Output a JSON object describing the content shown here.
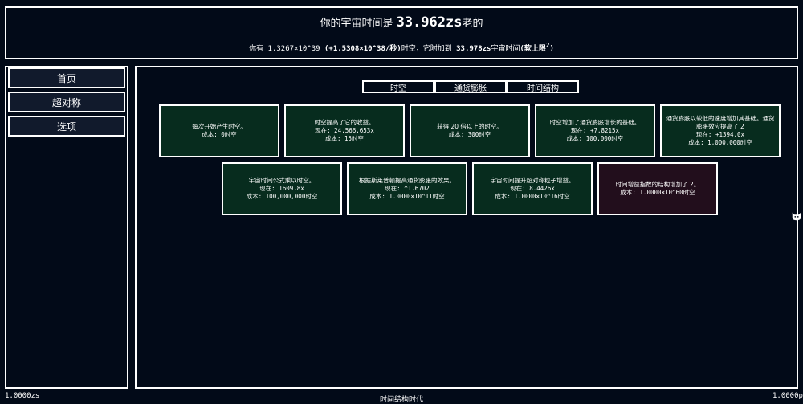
{
  "header": {
    "line1_prefix": "你的宇宙时间是 ",
    "line1_value": "33.962zs",
    "line1_suffix": "老的",
    "line2_prefix": "你有  ",
    "line2_amount": "1.3267×10^39",
    "line2_rate": "(+1.5308×10^38/秒)",
    "line2_mid": "时空，它附加到  ",
    "line2_value": "33.978zs",
    "line2_after": "宇宙时间",
    "line2_bold": "(软上限",
    "line2_sup": "2",
    "line2_close": ")"
  },
  "sidebar": {
    "items": [
      {
        "label": "首页"
      },
      {
        "label": "超对称"
      },
      {
        "label": "选项"
      }
    ]
  },
  "tabs": [
    {
      "label": "时空"
    },
    {
      "label": "通货膨胀"
    },
    {
      "label": "时间结构"
    }
  ],
  "upgrades": [
    {
      "desc": "每次开始产生时空。",
      "current": "",
      "cost": "成本:  0时空",
      "state": "bought"
    },
    {
      "desc": "时空提高了它的收益。",
      "current": "现在:  24,566,653x",
      "cost": "成本:  15时空",
      "state": "bought"
    },
    {
      "desc": "获得 20 倍以上的时空。",
      "current": "",
      "cost": "成本:  300时空",
      "state": "bought"
    },
    {
      "desc": "时空增加了通货膨胀增长的基础。",
      "current": "现在:  +7.8215x",
      "cost": "成本:  100,000时空",
      "state": "bought"
    },
    {
      "desc": "通货膨胀以较低的速度增加其基础。通货膨胀效应提高了 2",
      "current": "现在:  +1394.0x",
      "cost": "成本:  1,000,000时空",
      "state": "bought"
    },
    {
      "desc": "宇宙时间公式乘以时空。",
      "current": "现在:  1609.8x",
      "cost": "成本:  100,000,000时空",
      "state": "bought"
    },
    {
      "desc": "根据斯莱普顿提高通货膨胀的效果。",
      "current": "现在:  ^1.6702",
      "cost": "成本:  1.0000×10^11时空",
      "state": "bought"
    },
    {
      "desc": "宇宙时间提升超对称粒子增益。",
      "current": "现在:  8.4426x",
      "cost": "成本:  1.0000×10^16时空",
      "state": "bought"
    },
    {
      "desc": "时间增益指数的结构增加了 2。",
      "current": "",
      "cost": "成本:  1.0000×10^60时空",
      "state": "locked"
    }
  ],
  "footer": {
    "left": "1.0000zs",
    "center": "时间结构时代",
    "right": "1.0000ps"
  },
  "colors": {
    "background": "#020a18",
    "upgrade_bought": "#072c1e",
    "upgrade_locked": "#220e1c",
    "border": "#ffffff"
  },
  "icons": {
    "corner": "cat-icon"
  }
}
